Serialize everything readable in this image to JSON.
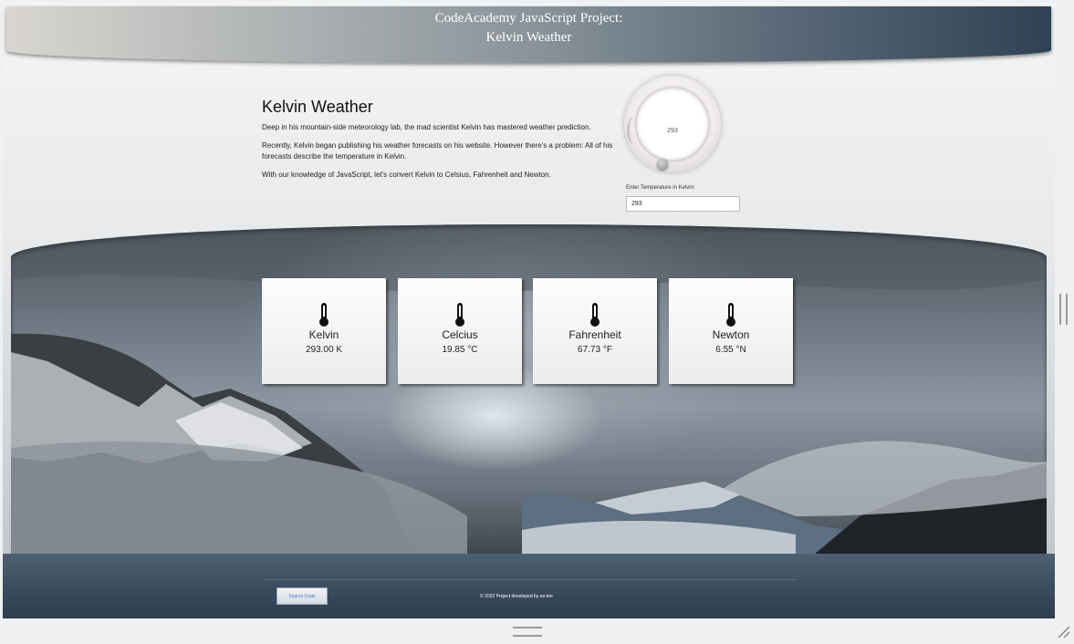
{
  "header": {
    "line1": "CodeAcademy JavaScript Project:",
    "line2": "Kelvin Weather"
  },
  "intro": {
    "title": "Kelvin Weather",
    "p1": "Deep in his mountain-side meteorology lab, the mad scientist Kelvin has mastered weather prediction.",
    "p2": "Recently, Kelvin began publishing his weather forecasts on his website. However there's a problem: All of his forecasts describe the temperature in Kelvin.",
    "p3": "With our knowledge of JavaScript, let's convert Kelvin to Celsius, Fahrenheit and Newton."
  },
  "dial": {
    "value": "293"
  },
  "kelvin_input": {
    "label": "Enter Temperature in Kelvin:",
    "value": "293"
  },
  "cards": [
    {
      "name": "Kelvin",
      "value": "293.00 K"
    },
    {
      "name": "Celcius",
      "value": "19.85 °C"
    },
    {
      "name": "Fahrenheit",
      "value": "67.73 °F"
    },
    {
      "name": "Newton",
      "value": "6.55 °N"
    }
  ],
  "footer": {
    "source_button": "Source Code",
    "copyright": "© 2022 Project developed by ee-tee"
  },
  "icons": {
    "card_icon": "thermometer-icon",
    "knob": "slider-knob"
  }
}
